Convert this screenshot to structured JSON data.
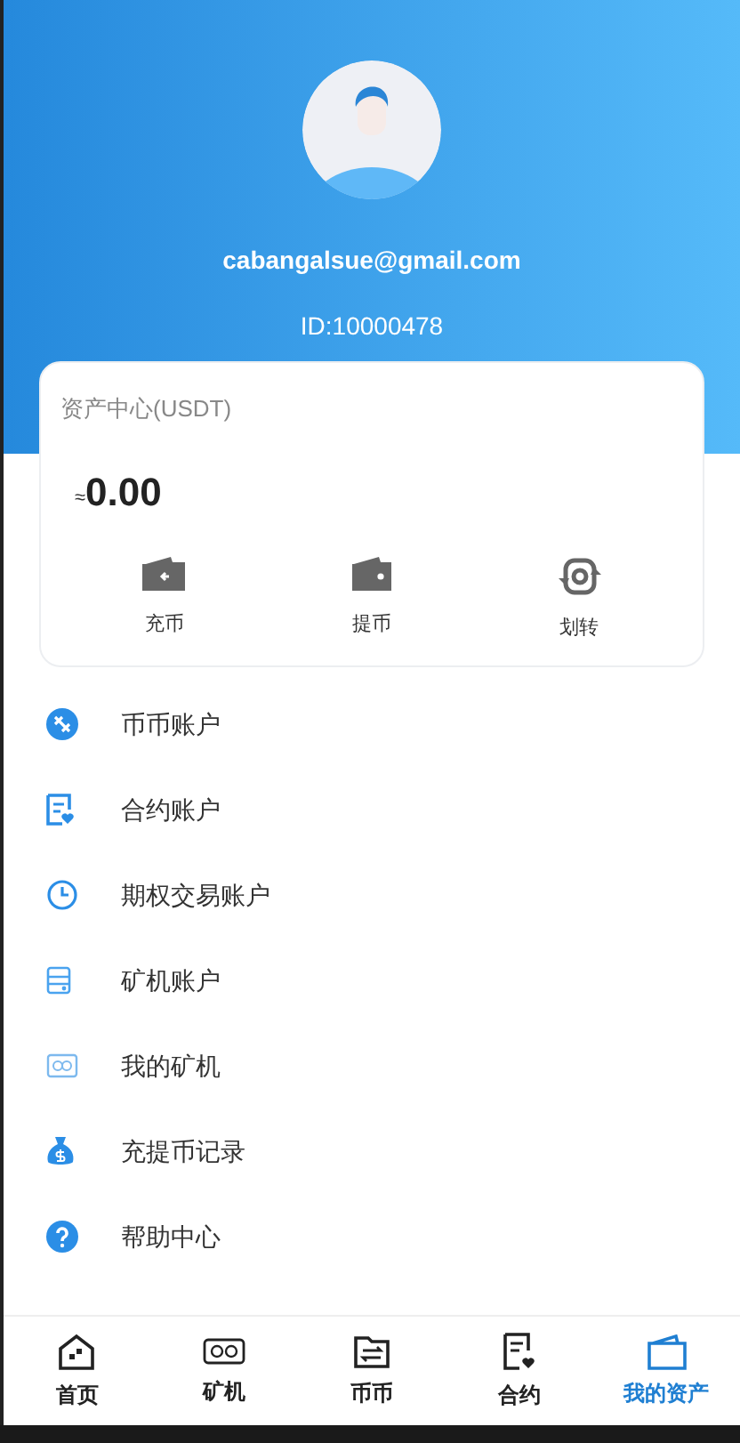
{
  "profile": {
    "email": "cabangalsue@gmail.com",
    "id": "ID:10000478"
  },
  "asset_card": {
    "title": "资产中心(USDT)",
    "approx": "≈",
    "balance": "0.00",
    "actions": [
      {
        "label": "充币",
        "kind": "deposit"
      },
      {
        "label": "提币",
        "kind": "withdraw"
      },
      {
        "label": "划转",
        "kind": "transfer"
      }
    ]
  },
  "menu": [
    {
      "label": "币币账户",
      "kind": "spot"
    },
    {
      "label": "合约账户",
      "kind": "contract"
    },
    {
      "label": "期权交易账户",
      "kind": "options"
    },
    {
      "label": "矿机账户",
      "kind": "miner-account"
    },
    {
      "label": "我的矿机",
      "kind": "my-miner"
    },
    {
      "label": "充提币记录",
      "kind": "records"
    },
    {
      "label": "帮助中心",
      "kind": "help"
    }
  ],
  "tab_bar": [
    {
      "label": "首页",
      "kind": "home",
      "selected": false
    },
    {
      "label": "矿机",
      "kind": "miner",
      "selected": false
    },
    {
      "label": "币币",
      "kind": "exchange",
      "selected": false
    },
    {
      "label": "合约",
      "kind": "contract",
      "selected": false
    },
    {
      "label": "我的资产",
      "kind": "assets",
      "selected": true
    }
  ]
}
